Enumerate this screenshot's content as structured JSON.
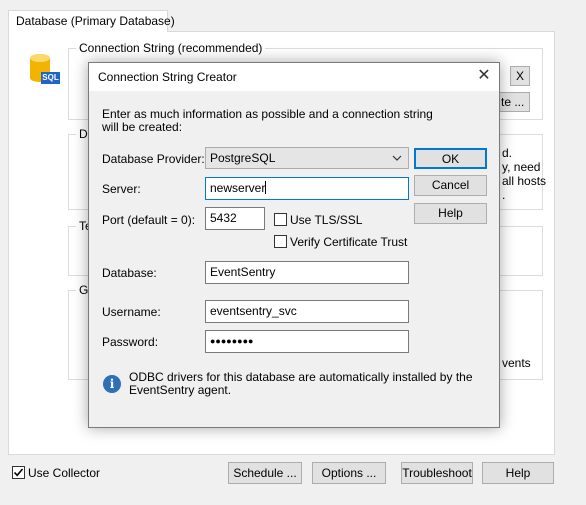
{
  "window": {
    "tab_label": "Database (Primary Database)",
    "connection_string_group": "Connection String (recommended)",
    "db_icon_text": "SQL",
    "clear_button": "X",
    "create_button": "te ...",
    "dsn_group": "DS",
    "right_text": [
      "d.",
      "y, need",
      "all hosts",
      "."
    ],
    "test_group": "Te",
    "general_group": "Ge",
    "events_text": "vents"
  },
  "bottom": {
    "use_collector_label": "Use Collector",
    "use_collector_checked": true,
    "schedule_button": "Schedule ...",
    "options_button": "Options ...",
    "troubleshoot_button": "Troubleshoot",
    "help_button": "Help"
  },
  "dialog": {
    "title": "Connection String Creator",
    "close_glyph": "✕",
    "intro_line1": "Enter as much information as possible and a connection string",
    "intro_line2": "will be created:",
    "provider_label": "Database Provider:",
    "provider_value": "PostgreSQL",
    "server_label": "Server:",
    "server_value": "newserver",
    "port_label": "Port (default = 0):",
    "port_value": "5432",
    "tls_label": "Use TLS/SSL",
    "tls_checked": false,
    "verify_label": "Verify Certificate Trust",
    "verify_checked": false,
    "database_label": "Database:",
    "database_value": "EventSentry",
    "username_label": "Username:",
    "username_value": "eventsentry_svc",
    "password_label": "Password:",
    "password_value": "●●●●●●●●",
    "info_line1": "ODBC drivers for this database are automatically installed by the",
    "info_line2": "EventSentry agent.",
    "ok_button": "OK",
    "cancel_button": "Cancel",
    "help_button": "Help"
  },
  "colors": {
    "accent": "#0078d7",
    "info": "#2f6fb7",
    "db_icon": "#f2b400"
  }
}
